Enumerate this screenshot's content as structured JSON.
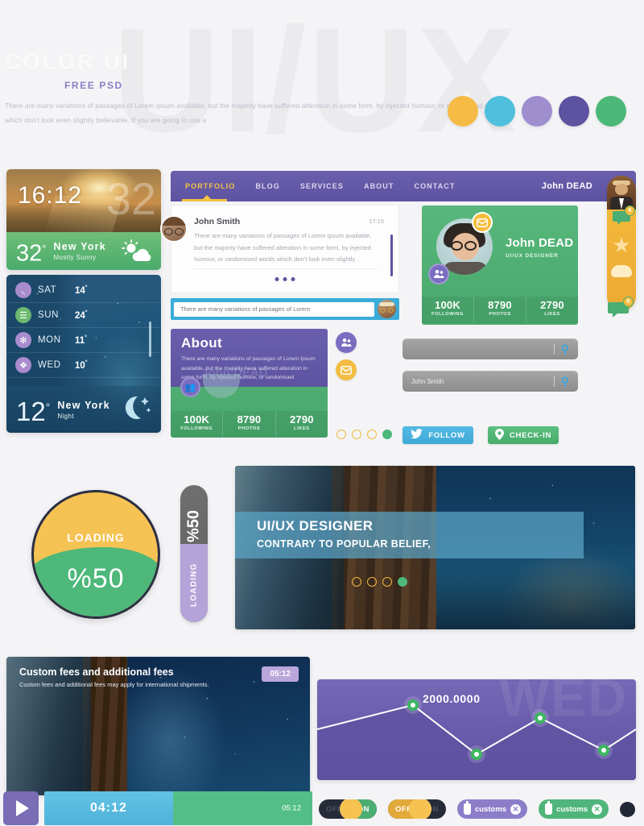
{
  "background": {
    "watermark_text": "UI/UX",
    "color_label": "COLOR"
  },
  "header": {
    "title": "COLOR UI",
    "subtitle": "FREE PSD",
    "paragraph": "There are many variations of passages of Lorem Ipsum available, but the majority have suffered alteration in some form, by injected humour, or randomised words which don't look even slightly believable. If you are going to use a"
  },
  "swatches": [
    {
      "name": "yellow",
      "hex": "#f5bb45"
    },
    {
      "name": "blue",
      "hex": "#4ebfdd"
    },
    {
      "name": "lavender",
      "hex": "#9f8ece"
    },
    {
      "name": "purple",
      "hex": "#5d53a0"
    },
    {
      "name": "green",
      "hex": "#4cb877"
    }
  ],
  "weather_day": {
    "time": "16:12",
    "ghost_temp": "32",
    "temp": "32",
    "degree": "°",
    "city": "New York",
    "condition": "Mostly Sunny",
    "icon": "sun-cloud-icon"
  },
  "weather_night": {
    "forecast": [
      {
        "day": "SAT",
        "temp": "14",
        "icon": "swirl-icon",
        "icon_color": "#a98ccd"
      },
      {
        "day": "SUN",
        "temp": "24",
        "icon": "rain-icon",
        "icon_color": "#6cb96f"
      },
      {
        "day": "MON",
        "temp": "11",
        "icon": "snow-icon",
        "icon_color": "#a98ccd"
      },
      {
        "day": "WED",
        "temp": "10",
        "icon": "hail-icon",
        "icon_color": "#a98ccd"
      }
    ],
    "temp": "12",
    "degree": "°",
    "city": "New York",
    "condition": "Night",
    "icon": "moon-stars-icon"
  },
  "nav": {
    "items": [
      {
        "label": "PORTFOLIO",
        "active": true
      },
      {
        "label": "BLOG",
        "active": false
      },
      {
        "label": "SERVICES",
        "active": false
      },
      {
        "label": "ABOUT",
        "active": false
      },
      {
        "label": "CONTACT",
        "active": false
      }
    ],
    "user": "John DEAD"
  },
  "side_tab": {
    "message_badge": "6",
    "floating_badge": "6",
    "icons": [
      "message-icon",
      "star-icon",
      "cloud-icon"
    ]
  },
  "chat": {
    "name": "John Smith",
    "time": "17:15",
    "message": "There are many variations of passages of Lorem Ipsum available, but the majority have suffered alteration in some form, by injected humour, or randomised words which don't look even slightly .",
    "input_placeholder": "There are many variations of passages of Lorem"
  },
  "about": {
    "title": "About",
    "text": "There are many variations of passages of Lorem Ipsum available, but the majority have suffered alteration in some form, by injected humour, or randomised",
    "ghost_name": "John DEAD",
    "stats": [
      {
        "value": "100K",
        "label": "FOLLOWING"
      },
      {
        "value": "8790",
        "label": "PHOTOS"
      },
      {
        "value": "2790",
        "label": "LIKES"
      }
    ]
  },
  "profile": {
    "name": "John DEAD",
    "role": "UI/UX DESIGNER",
    "mail_icon": "mail-icon",
    "people_icon": "people-icon",
    "stats": [
      {
        "value": "100K",
        "label": "FOLLOWING"
      },
      {
        "value": "8790",
        "label": "PHOTOS"
      },
      {
        "value": "2790",
        "label": "LIKES"
      }
    ]
  },
  "bubbles": [
    {
      "icon": "people-icon",
      "glyph": "\u0001",
      "hex": "#7a6cc0"
    },
    {
      "icon": "mail-icon",
      "glyph": "\u0001",
      "hex": "#f4bd42"
    }
  ],
  "search": {
    "empty_placeholder": "",
    "filled_value": "John Smith",
    "icon": "search-icon"
  },
  "buttons": {
    "follow": {
      "label": "FOLLOW",
      "icon": "twitter-icon"
    },
    "checkin": {
      "label": "CHECK-IN",
      "icon": "map-pin-icon"
    }
  },
  "pagers": {
    "pager_1": {
      "total": 4,
      "active_index": 3
    },
    "pager_2": {
      "total": 4,
      "active_index": 3
    }
  },
  "loader": {
    "label": "LOADING",
    "percent": "%50",
    "fill_ratio": 50
  },
  "vertical_progress": {
    "percent": "%50",
    "label": "LOADING",
    "fill_ratio": 50
  },
  "hero": {
    "title": "UI/UX DESIGNER",
    "subtitle": "CONTRARY TO POPULAR BELIEF,"
  },
  "video": {
    "title": "Custom fees and additional fees",
    "subtitle": "Custom fees and additional fees may apply for international shipments.",
    "duration_chip": "05:12",
    "current_time": "04:12",
    "total_time": "05:12",
    "play_icon": "play-icon",
    "progress_ratio": 48
  },
  "chart_data": {
    "type": "line",
    "title": "",
    "watermark": "WED",
    "annotation": "2000.0000",
    "x": [
      0,
      1,
      2,
      3,
      4,
      5
    ],
    "values": [
      1450,
      2000.0,
      700,
      1750,
      810,
      1500
    ],
    "series": [
      {
        "name": "value",
        "values": [
          1450,
          2000.0,
          700,
          1750,
          810,
          1500
        ]
      }
    ],
    "point_labels": [
      "",
      "2000.0000",
      "",
      "",
      "",
      ""
    ],
    "marker_color": "#3cb860",
    "line_color": "#ffffff",
    "area_fill": "#5d52a0",
    "background": "#6a5dad",
    "grid": false,
    "legend": "none",
    "xlabel": "",
    "ylabel": "",
    "ylim": [
      0,
      2400
    ]
  },
  "toggles": [
    {
      "name": "toggle-off-on-green",
      "off_label": "OFF",
      "on_label": "ON",
      "state": "on"
    },
    {
      "name": "toggle-off-on-amber",
      "off_label": "OFF",
      "on_label": "ON",
      "state": "off"
    }
  ],
  "chips": [
    {
      "label": "customs",
      "color": "#8c7dc9",
      "icon": "bottle-icon",
      "close_icon": "close-icon"
    },
    {
      "label": "customs",
      "color": "#4fb57a",
      "icon": "bottle-icon",
      "close_icon": "close-icon"
    }
  ],
  "radio_dots": [
    {
      "name": "radio-unselected",
      "selected": false
    },
    {
      "name": "radio-selected",
      "selected": true
    }
  ]
}
